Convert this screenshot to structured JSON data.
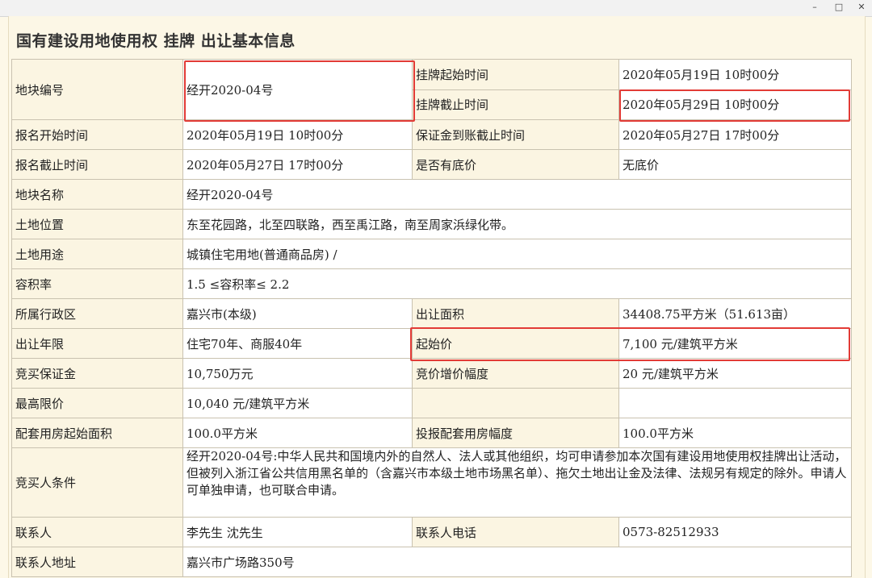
{
  "window": {
    "minimize_glyph": "–",
    "maximize_glyph": "□",
    "close_glyph": "✕"
  },
  "page_title": "国有建设用地使用权 挂牌 出让基本信息",
  "rows": {
    "plot_no": {
      "label": "地块编号",
      "value": "经开2020-04号"
    },
    "listing_start": {
      "label": "挂牌起始时间",
      "value": "2020年05月19日 10时00分"
    },
    "listing_end": {
      "label": "挂牌截止时间",
      "value": "2020年05月29日 10时00分"
    },
    "reg_start": {
      "label": "报名开始时间",
      "value": "2020年05月19日 10时00分"
    },
    "deposit_deadline": {
      "label": "保证金到账截止时间",
      "value": "2020年05月27日 17时00分"
    },
    "reg_end": {
      "label": "报名截止时间",
      "value": "2020年05月27日 17时00分"
    },
    "reserve_price": {
      "label": "是否有底价",
      "value": "无底价"
    },
    "plot_name": {
      "label": "地块名称",
      "value": "经开2020-04号"
    },
    "location": {
      "label": "土地位置",
      "value": "东至花园路，北至四联路，西至禹江路，南至周家浜绿化带。"
    },
    "land_use": {
      "label": "土地用途",
      "value": "城镇住宅用地(普通商品房) /"
    },
    "far": {
      "label": "容积率",
      "value": "1.5 ≤容积率≤ 2.2"
    },
    "district": {
      "label": "所属行政区",
      "value": "嘉兴市(本级)"
    },
    "area": {
      "label": "出让面积",
      "value": "34408.75平方米（51.613亩）"
    },
    "term": {
      "label": "出让年限",
      "value": "住宅70年、商服40年"
    },
    "start_price": {
      "label": "起始价",
      "value": "7,100 元/建筑平方米"
    },
    "bid_deposit": {
      "label": "竞买保证金",
      "value": "10,750万元"
    },
    "increment": {
      "label": "竞价增价幅度",
      "value": "20 元/建筑平方米"
    },
    "max_price": {
      "label": "最高限价",
      "value": "10,040 元/建筑平方米"
    },
    "housing_start": {
      "label": "配套用房起始面积",
      "value": "100.0平方米"
    },
    "housing_step": {
      "label": "投报配套用房幅度",
      "value": "100.0平方米"
    },
    "conditions": {
      "label": "竞买人条件",
      "value": "经开2020-04号:中华人民共和国境内外的自然人、法人或其他组织，均可申请参加本次国有建设用地使用权挂牌出让活动，但被列入浙江省公共信用黑名单的（含嘉兴市本级土地市场黑名单）、拖欠土地出让金及法律、法规另有规定的除外。申请人可单独申请，也可联合申请。"
    },
    "contact": {
      "label": "联系人",
      "value": "李先生 沈先生"
    },
    "phone": {
      "label": "联系人电话",
      "value": "0573-82512933"
    },
    "address": {
      "label": "联系人地址",
      "value": "嘉兴市广场路350号"
    }
  },
  "colors": {
    "highlight": "#e23b36",
    "page_bg": "#fcf7e6",
    "border": "#c9c2b0"
  }
}
